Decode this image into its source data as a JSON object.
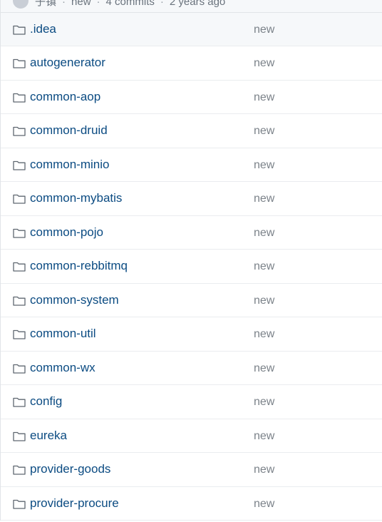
{
  "header": {
    "text_parts": [
      "子镇",
      "new",
      "4 commits",
      "2 years ago"
    ]
  },
  "files": [
    {
      "name": ".idea",
      "message": "new",
      "icon": "folder-icon"
    },
    {
      "name": "autogenerator",
      "message": "new",
      "icon": "folder-icon"
    },
    {
      "name": "common-aop",
      "message": "new",
      "icon": "folder-icon"
    },
    {
      "name": "common-druid",
      "message": "new",
      "icon": "folder-icon"
    },
    {
      "name": "common-minio",
      "message": "new",
      "icon": "folder-icon"
    },
    {
      "name": "common-mybatis",
      "message": "new",
      "icon": "folder-icon"
    },
    {
      "name": "common-pojo",
      "message": "new",
      "icon": "folder-icon"
    },
    {
      "name": "common-rebbitmq",
      "message": "new",
      "icon": "folder-icon"
    },
    {
      "name": "common-system",
      "message": "new",
      "icon": "folder-icon"
    },
    {
      "name": "common-util",
      "message": "new",
      "icon": "folder-icon"
    },
    {
      "name": "common-wx",
      "message": "new",
      "icon": "folder-icon"
    },
    {
      "name": "config",
      "message": "new",
      "icon": "folder-icon"
    },
    {
      "name": "eureka",
      "message": "new",
      "icon": "folder-icon"
    },
    {
      "name": "provider-goods",
      "message": "new",
      "icon": "folder-icon"
    },
    {
      "name": "provider-procure",
      "message": "new",
      "icon": "folder-icon"
    }
  ],
  "colors": {
    "link": "#0b4b82",
    "muted": "#7b8289",
    "border": "#eaecef",
    "header_bg": "#f6f8fa"
  }
}
